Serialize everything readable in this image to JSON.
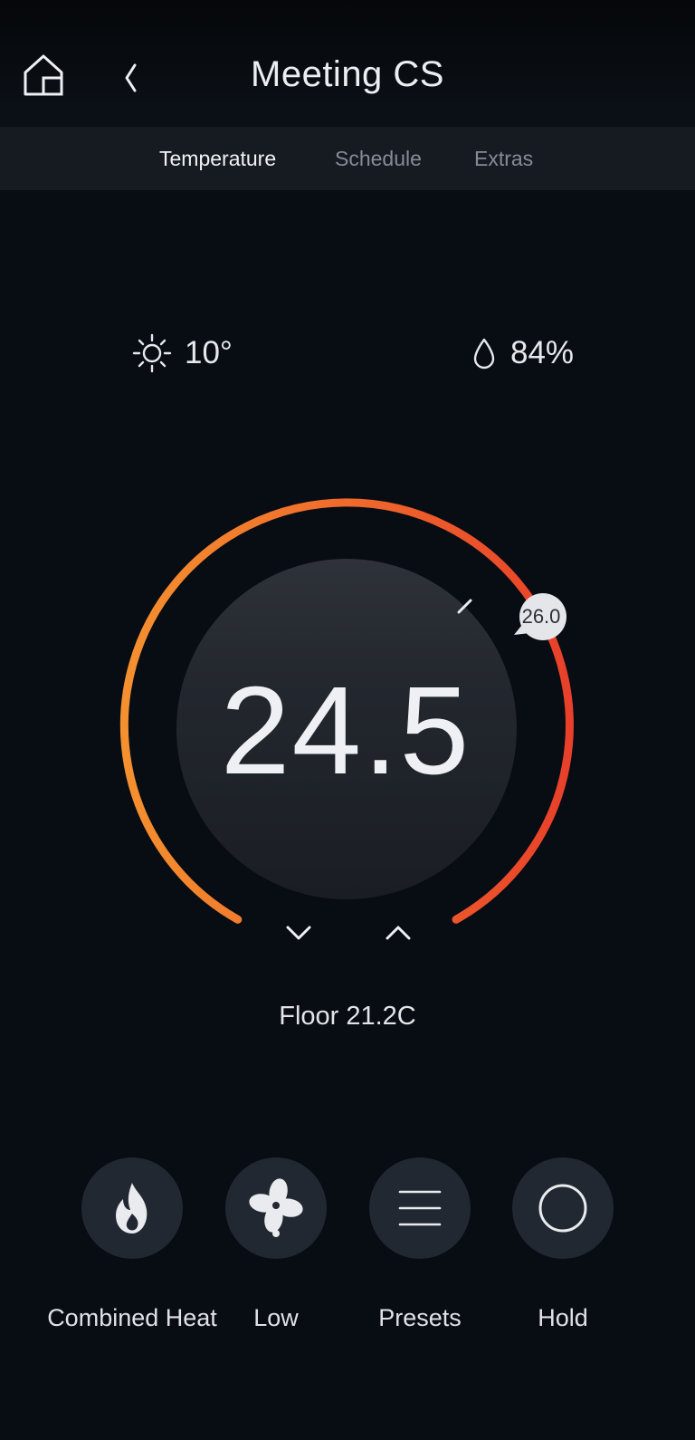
{
  "header": {
    "title": "Meeting CS"
  },
  "tabs": [
    {
      "label": "Temperature",
      "active": true
    },
    {
      "label": "Schedule",
      "active": false
    },
    {
      "label": "Extras",
      "active": false
    }
  ],
  "weather": {
    "outdoor_temp": "10°",
    "humidity": "84%",
    "outdoor_icon": "sun-icon",
    "humidity_icon": "droplet-icon"
  },
  "thermostat": {
    "current_temp": "24.5",
    "setpoint": "26.0",
    "floor_label": "Floor 21.2C"
  },
  "controls": [
    {
      "label": "Combined Heat",
      "icon": "flame-icon"
    },
    {
      "label": "Low",
      "icon": "fan-icon"
    },
    {
      "label": "Presets",
      "icon": "menu-icon"
    },
    {
      "label": "Hold",
      "icon": "circle-icon"
    }
  ],
  "colors": {
    "background": "#080c13",
    "tab_bar": "#161b22",
    "arc_start": "#f4902f",
    "arc_end": "#e8402a",
    "button_bg": "#222831"
  }
}
